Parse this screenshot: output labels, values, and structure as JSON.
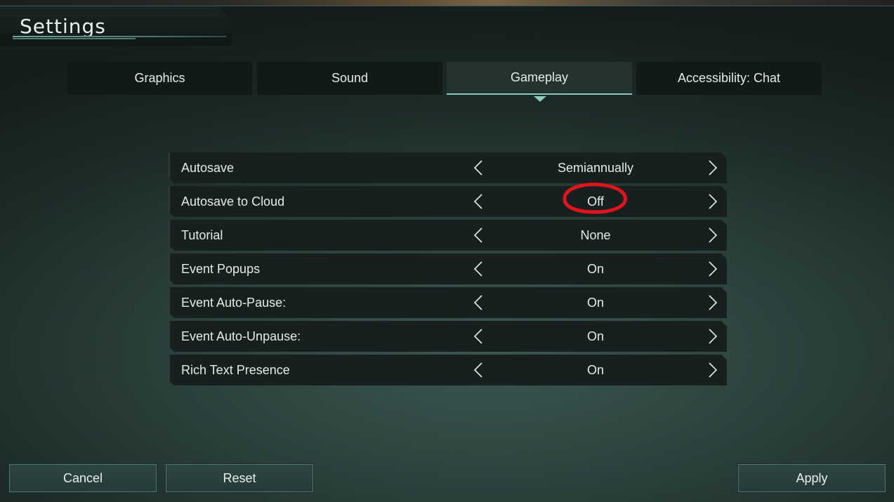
{
  "window": {
    "title": "Settings"
  },
  "tabs": [
    {
      "label": "Graphics",
      "active": false
    },
    {
      "label": "Sound",
      "active": false
    },
    {
      "label": "Gameplay",
      "active": true
    },
    {
      "label": "Accessibility: Chat",
      "active": false
    }
  ],
  "settings": [
    {
      "label": "Autosave",
      "value": "Semiannually"
    },
    {
      "label": "Autosave to Cloud",
      "value": "Off"
    },
    {
      "label": "Tutorial",
      "value": "None"
    },
    {
      "label": "Event Popups",
      "value": "On"
    },
    {
      "label": "Event Auto-Pause:",
      "value": "On"
    },
    {
      "label": "Event Auto-Unpause:",
      "value": "On"
    },
    {
      "label": "Rich Text Presence",
      "value": "On"
    }
  ],
  "buttons": {
    "cancel": "Cancel",
    "reset": "Reset",
    "apply": "Apply"
  },
  "icons": {
    "prev": "chevron-left-icon",
    "next": "chevron-right-icon"
  },
  "colors": {
    "accent": "#8fc8bc",
    "annotation": "#e0141c"
  }
}
